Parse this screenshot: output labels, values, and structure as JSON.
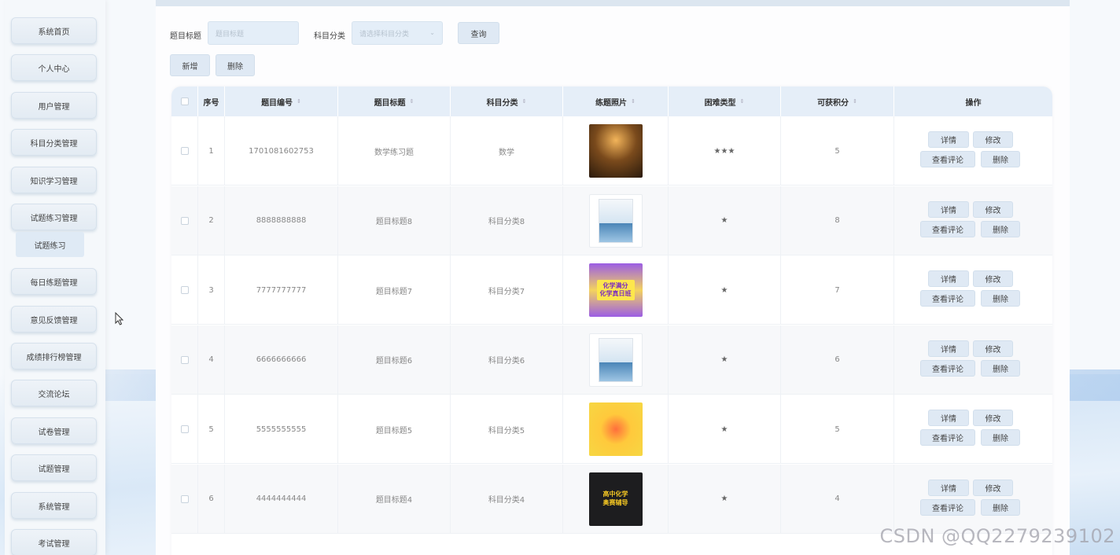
{
  "sidebar": {
    "items": [
      {
        "label": "系统首页"
      },
      {
        "label": "个人中心"
      },
      {
        "label": "用户管理"
      },
      {
        "label": "科目分类管理"
      },
      {
        "label": "知识学习管理"
      },
      {
        "label": "试题练习管理"
      },
      {
        "label": "每日练题管理"
      },
      {
        "label": "意见反馈管理"
      },
      {
        "label": "成绩排行榜管理"
      },
      {
        "label": "交流论坛"
      },
      {
        "label": "试卷管理"
      },
      {
        "label": "试题管理"
      },
      {
        "label": "系统管理"
      },
      {
        "label": "考试管理"
      }
    ],
    "submenu": {
      "label": "试题练习"
    }
  },
  "search": {
    "title_label": "题目标题",
    "title_placeholder": "题目标题",
    "category_label": "科目分类",
    "category_placeholder": "请选择科目分类",
    "query_button": "查询"
  },
  "toolbar": {
    "add_button": "新增",
    "delete_button": "删除"
  },
  "table": {
    "headers": {
      "index": "序号",
      "code": "题目编号",
      "title": "题目标题",
      "category": "科目分类",
      "photo": "练题照片",
      "difficulty": "困难类型",
      "points": "可获积分",
      "actions": "操作"
    },
    "actions": {
      "detail": "详情",
      "edit": "修改",
      "comments": "查看评论",
      "delete": "删除"
    },
    "rows": [
      {
        "index": "1",
        "code": "1701081602753",
        "title": "数学练习题",
        "category": "数学",
        "difficulty": "★★★",
        "points": "5"
      },
      {
        "index": "2",
        "code": "8888888888",
        "title": "题目标题8",
        "category": "科目分类8",
        "difficulty": "★",
        "points": "8"
      },
      {
        "index": "3",
        "code": "7777777777",
        "title": "题目标题7",
        "category": "科目分类7",
        "difficulty": "★",
        "points": "7"
      },
      {
        "index": "4",
        "code": "6666666666",
        "title": "题目标题6",
        "category": "科目分类6",
        "difficulty": "★",
        "points": "6"
      },
      {
        "index": "5",
        "code": "5555555555",
        "title": "题目标题5",
        "category": "科目分类5",
        "difficulty": "★",
        "points": "5"
      },
      {
        "index": "6",
        "code": "4444444444",
        "title": "题目标题4",
        "category": "科目分类4",
        "difficulty": "★",
        "points": "4"
      }
    ],
    "thumb_texts": {
      "row3_line1": "化学满分",
      "row3_line2": "化学真日班",
      "row6_line1": "高中化学",
      "row6_line2": "奥赛辅导"
    }
  },
  "watermark": "CSDN @QQ2279239102"
}
